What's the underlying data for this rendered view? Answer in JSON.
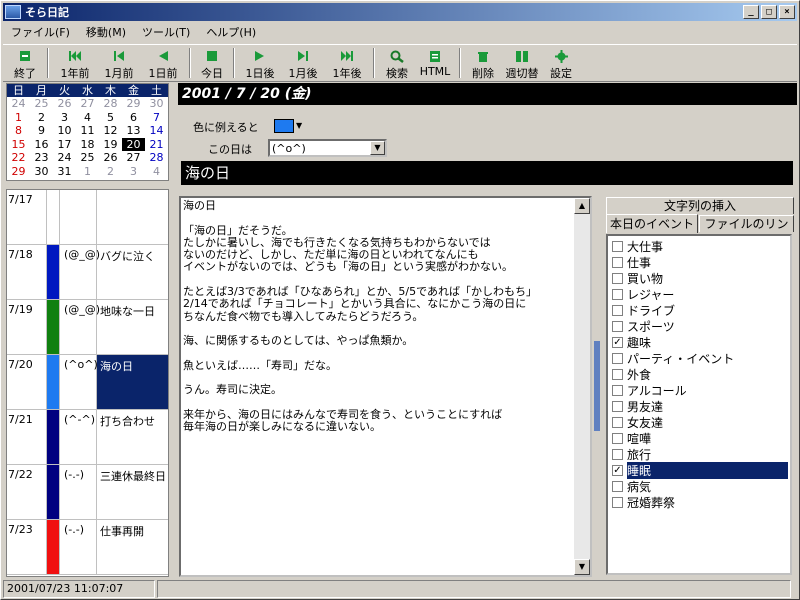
{
  "window": {
    "title": "そら日記"
  },
  "menu": [
    "ファイル(F)",
    "移動(M)",
    "ツール(T)",
    "ヘルプ(H)"
  ],
  "toolbar": {
    "exit": "終了",
    "prev_year": "1年前",
    "prev_month": "1月前",
    "prev_day": "1日前",
    "today": "今日",
    "next_day": "1日後",
    "next_month": "1月後",
    "next_year": "1年後",
    "search": "検索",
    "html": "HTML",
    "delete": "削除",
    "week_toggle": "週切替",
    "settings": "設定"
  },
  "calendar": {
    "weekdays": [
      "日",
      "月",
      "火",
      "水",
      "木",
      "金",
      "土"
    ],
    "weeks": [
      [
        "24",
        "25",
        "26",
        "27",
        "28",
        "29",
        "30"
      ],
      [
        "1",
        "2",
        "3",
        "4",
        "5",
        "6",
        "7"
      ],
      [
        "8",
        "9",
        "10",
        "11",
        "12",
        "13",
        "14"
      ],
      [
        "15",
        "16",
        "17",
        "18",
        "19",
        "20",
        "21"
      ],
      [
        "22",
        "23",
        "24",
        "25",
        "26",
        "27",
        "28"
      ],
      [
        "29",
        "30",
        "31",
        "1",
        "2",
        "3",
        "4"
      ]
    ],
    "selected": "20",
    "colors": {
      "sunday": "#d00000",
      "saturday": "#0000c0",
      "other_month": "#9090a0"
    }
  },
  "diary": [
    {
      "date": "7/17",
      "face": "",
      "title": "",
      "color": "#ffffff"
    },
    {
      "date": "7/18",
      "face": "(@_@)",
      "title": "バグに泣く",
      "color": "#0018c0"
    },
    {
      "date": "7/19",
      "face": "(@_@)",
      "title": "地味な一日",
      "color": "#108010"
    },
    {
      "date": "7/20",
      "face": "(^o^)",
      "title": "海の日",
      "color": "#1e7af0"
    },
    {
      "date": "7/21",
      "face": "(^-^)",
      "title": "打ち合わせ",
      "color": "#000080"
    },
    {
      "date": "7/22",
      "face": "(-.-)",
      "title": "三連休最終日",
      "color": "#000080"
    },
    {
      "date": "7/23",
      "face": "(-.-)",
      "title": "仕事再開",
      "color": "#f01010"
    }
  ],
  "entry": {
    "date_heading": "2001 / 7 / 20 (金)",
    "color_label": "色に例えると",
    "face_label": "この日は",
    "face_value": "(^o^)",
    "color_value": "#1e7af0",
    "title": "海の日",
    "body": "海の日\n\n「海の日」だそうだ。\nたしかに暑いし、海でも行きたくなる気持ちもわからないでは\nないのだけど、しかし、ただ単に海の日といわれてなんにも\nイベントがないのでは、どうも「海の日」という実感がわかない。\n\nたとえば3/3であれば「ひなあられ」とか、5/5であれば「かしわもち」\n2/14であれば「チョコレート」とかいう具合に、なにかこう海の日に\nちなんだ食べ物でも導入してみたらどうだろう。\n\n海、に関係するものとしては、やっぱ魚類か。\n\n魚といえば……「寿司」だな。\n\nうん。寿司に決定。\n\n来年から、海の日にはみんなで寿司を食う、ということにすれば\n毎年海の日が楽しみになるに違いない。"
  },
  "tabs": {
    "insert": "文字列の挿入",
    "events": "本日のイベント",
    "file_link": "ファイルのリンク"
  },
  "events": [
    {
      "label": "大仕事",
      "checked": false
    },
    {
      "label": "仕事",
      "checked": false
    },
    {
      "label": "買い物",
      "checked": false
    },
    {
      "label": "レジャー",
      "checked": false
    },
    {
      "label": "ドライブ",
      "checked": false
    },
    {
      "label": "スポーツ",
      "checked": false
    },
    {
      "label": "趣味",
      "checked": true
    },
    {
      "label": "パーティ・イベント",
      "checked": false
    },
    {
      "label": "外食",
      "checked": false
    },
    {
      "label": "アルコール",
      "checked": false
    },
    {
      "label": "男友達",
      "checked": false
    },
    {
      "label": "女友達",
      "checked": false
    },
    {
      "label": "喧嘩",
      "checked": false
    },
    {
      "label": "旅行",
      "checked": false
    },
    {
      "label": "睡眠",
      "checked": true,
      "selected": true
    },
    {
      "label": "病気",
      "checked": false
    },
    {
      "label": "冠婚葬祭",
      "checked": false
    }
  ],
  "status": {
    "datetime": "2001/07/23 11:07:07"
  }
}
